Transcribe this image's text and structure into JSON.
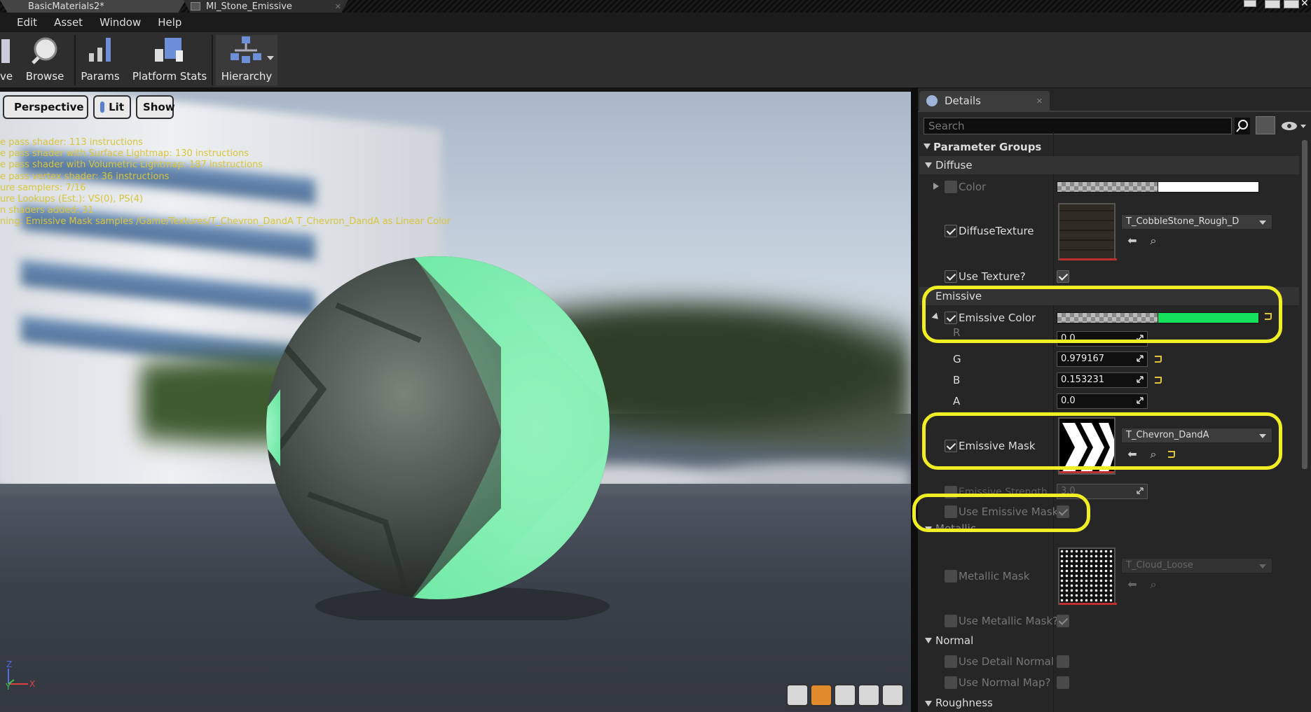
{
  "window": {
    "tabs": [
      {
        "label": "BasicMaterials2*"
      },
      {
        "label": "MI_Stone_Emissive"
      }
    ]
  },
  "menu": {
    "items": [
      "Edit",
      "Asset",
      "Window",
      "Help"
    ]
  },
  "toolbar": {
    "save_partial": "ve",
    "browse": "Browse",
    "params": "Params",
    "platform_stats": "Platform Stats",
    "hierarchy": "Hierarchy"
  },
  "viewport": {
    "perspective": "Perspective",
    "lit": "Lit",
    "show": "Show",
    "stats": [
      "e pass shader: 113 instructions",
      "e pass shader with Surface Lightmap: 130 instructions",
      "e pass shader with Volumetric Lightmap: 187 instructions",
      "e pass vertex shader: 36 instructions",
      "ure samplers: 7/16",
      "ure Lookups (Est.): VS(0), PS(4)",
      "n shaders added: 31",
      "ning: Emissive Mask samples /Game/Textures/T_Chevron_DandA T_Chevron_DandA as Linear Color"
    ],
    "axis": {
      "z": "Z",
      "y": "Y",
      "x": "X"
    }
  },
  "details": {
    "tab_label": "Details",
    "search_placeholder": "Search",
    "parameter_groups": "Parameter Groups",
    "diffuse": {
      "group": "Diffuse",
      "color": "Color",
      "diffuse_texture": "DiffuseTexture",
      "diffuse_texture_asset": "T_CobbleStone_Rough_D",
      "use_texture": "Use Texture?"
    },
    "emissive": {
      "group": "Emissive",
      "emissive_color": "Emissive Color",
      "r_label": "R",
      "r_value": "0.0",
      "g_label": "G",
      "g_value": "0.979167",
      "b_label": "B",
      "b_value": "0.153231",
      "a_label": "A",
      "a_value": "0.0",
      "emissive_mask": "Emissive Mask",
      "emissive_mask_asset": "T_Chevron_DandA",
      "emissive_strength": "Emissive Strength",
      "emissive_strength_value": "3.0",
      "use_emissive_mask": "Use Emissive Mask"
    },
    "metallic": {
      "group": "Metallic",
      "metallic_mask": "Metallic Mask",
      "metallic_mask_asset": "T_Cloud_Loose",
      "use_metallic_mask": "Use Metallic Mask?"
    },
    "normal": {
      "group": "Normal",
      "use_detail_normal": "Use Detail Normal M",
      "use_normal_map": "Use Normal Map?"
    },
    "roughness": {
      "group": "Roughness"
    }
  },
  "colors": {
    "emissive_green": "#14e05a",
    "highlight_yellow": "#f2ee24",
    "stats_text": "#d9c53a"
  }
}
